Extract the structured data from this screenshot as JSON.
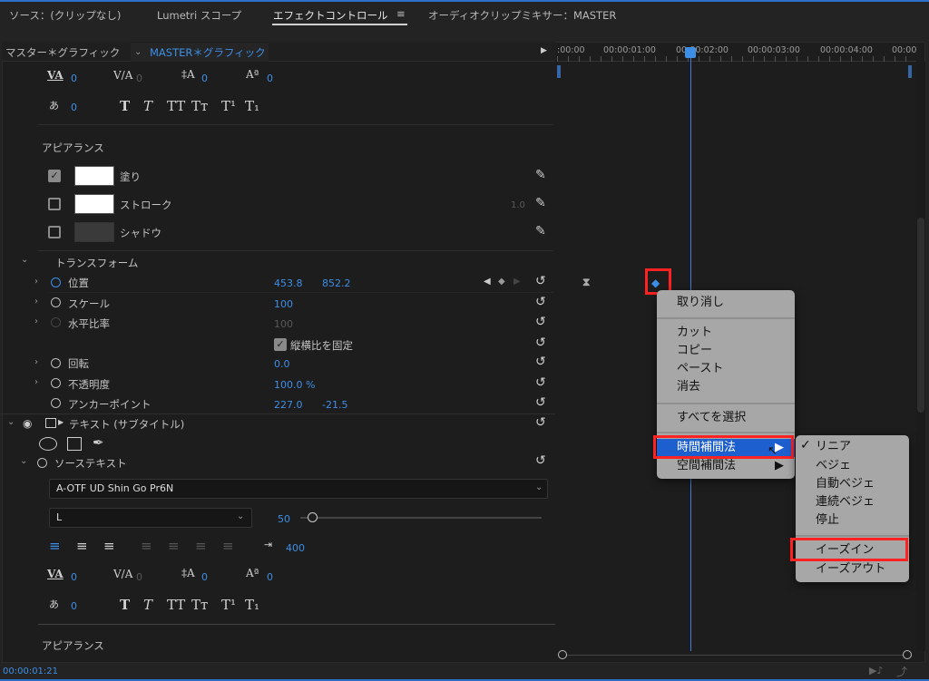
{
  "tabs": [
    {
      "label": "ソース：(クリップなし)"
    },
    {
      "label": "Lumetri スコープ"
    },
    {
      "label": "エフェクトコントロール"
    },
    {
      "label": "オーディオクリップミキサー：MASTER"
    }
  ],
  "tab_menu_icon": "≡",
  "header": {
    "master_label": "マスター＊グラフィック",
    "clip_label": "MASTER＊グラフィック"
  },
  "ruler": {
    "ticks": [
      ":00:00",
      "00:00:01:00",
      "00:00:02:00",
      "00:00:03:00",
      "00:00:04:00",
      "00:00"
    ]
  },
  "text_props_top": {
    "tracking": "0",
    "kerning": "0",
    "leading": "0",
    "baseline": "0",
    "tsume": "0"
  },
  "style_glyphs": [
    "T",
    "T",
    "TT",
    "Tт",
    "T¹",
    "T₁"
  ],
  "appearance": {
    "title": "アピアランス",
    "fill": {
      "label": "塗り",
      "checked": true,
      "color": "#ffffff"
    },
    "stroke": {
      "label": "ストローク",
      "checked": false,
      "width": "1.0",
      "color": "#ffffff"
    },
    "shadow": {
      "label": "シャドウ",
      "checked": false
    }
  },
  "transform": {
    "title": "トランスフォーム",
    "position": {
      "label": "位置",
      "x": "453.8",
      "y": "852.2"
    },
    "scale": {
      "label": "スケール",
      "value": "100"
    },
    "scale_width": {
      "label": "水平比率",
      "value": "100"
    },
    "uniform": {
      "label": "縦横比を固定",
      "checked": true
    },
    "rotation": {
      "label": "回転",
      "value": "0.0"
    },
    "opacity": {
      "label": "不透明度",
      "value": "100.0 %"
    },
    "anchor": {
      "label": "アンカーポイント",
      "x": "227.0",
      "y": "-21.5"
    }
  },
  "text_layer": {
    "label": "テキスト (サブタイトル)"
  },
  "source_text": {
    "label": "ソーステキスト",
    "font": "A-OTF UD Shin Go Pr6N",
    "weight": "L",
    "size": "50",
    "size_fraction": 0.05,
    "tab_width": "400",
    "tracking": "0",
    "kerning": "0",
    "leading": "0",
    "baseline": "0",
    "tsume": "0"
  },
  "appearance2": {
    "title": "アピアランス"
  },
  "context_menu": {
    "undo": "取り消し",
    "cut": "カット",
    "copy": "コピー",
    "paste": "ペースト",
    "clear": "消去",
    "select_all": "すべてを選択",
    "temporal": "時間補間法",
    "spatial": "空間補間法",
    "arrow": "▶"
  },
  "submenu": {
    "check": "✓",
    "items": [
      "リニア",
      "ベジェ",
      "自動ベジェ",
      "連続ベジェ",
      "停止",
      "イーズイン",
      "イーズアウト"
    ],
    "selected": "リニア"
  },
  "timecode": "00:00:01:21",
  "colors": {
    "accent": "#3d8ee6",
    "highlight": "#1e5fcf",
    "annotation": "#ff2a1a"
  }
}
